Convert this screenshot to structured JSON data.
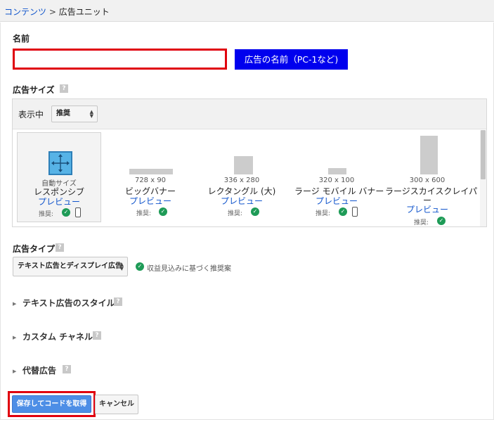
{
  "breadcrumb": {
    "link": "コンテンツ",
    "separator": " > ",
    "current": "広告ユニット"
  },
  "name_section": {
    "label": "名前",
    "input_value": "",
    "annotation": "広告の名前（PC-1など)"
  },
  "size_section": {
    "label": "広告サイズ",
    "help": "?",
    "display_label": "表示中",
    "filter_value": "推奨",
    "items": [
      {
        "top_label": "自動サイズ",
        "name": "レスポンシブ",
        "preview": "プレビュー",
        "recommended": "推奨:",
        "mobile": true,
        "selected": true
      },
      {
        "dims": "728 x 90",
        "name": "ビッグバナー",
        "preview": "プレビュー",
        "recommended": "推奨:",
        "mobile": false
      },
      {
        "dims": "336 x 280",
        "name": "レクタングル (大)",
        "preview": "プレビュー",
        "recommended": "推奨:",
        "mobile": false
      },
      {
        "dims": "320 x 100",
        "name": "ラージ モバイル バナー",
        "preview": "プレビュー",
        "recommended": "推奨:",
        "mobile": true
      },
      {
        "dims": "300 x 600",
        "name_line1": "ラージスカイスクレイパ",
        "name_line2": "ー",
        "preview": "プレビュー",
        "recommended": "推奨:",
        "mobile": false
      }
    ]
  },
  "type_section": {
    "label": "広告タイプ",
    "help": "?",
    "selected_value": "テキスト広告とディスプレイ広告",
    "hint": "収益見込みに基づく推奨案"
  },
  "collapsibles": [
    {
      "label": "テキスト広告のスタイル",
      "help": "?"
    },
    {
      "label": "カスタム チャネル",
      "help": "?"
    },
    {
      "label": "代替広告",
      "help": "?"
    }
  ],
  "actions": {
    "save_label": "保存してコードを取得",
    "cancel_label": "キャンセル"
  },
  "colors": {
    "accent_blue": "#4d8ee6",
    "link_blue": "#1155cc",
    "highlight_red": "#e0000e",
    "annotation_blue": "#0000ee",
    "check_green": "#1e9b57"
  }
}
